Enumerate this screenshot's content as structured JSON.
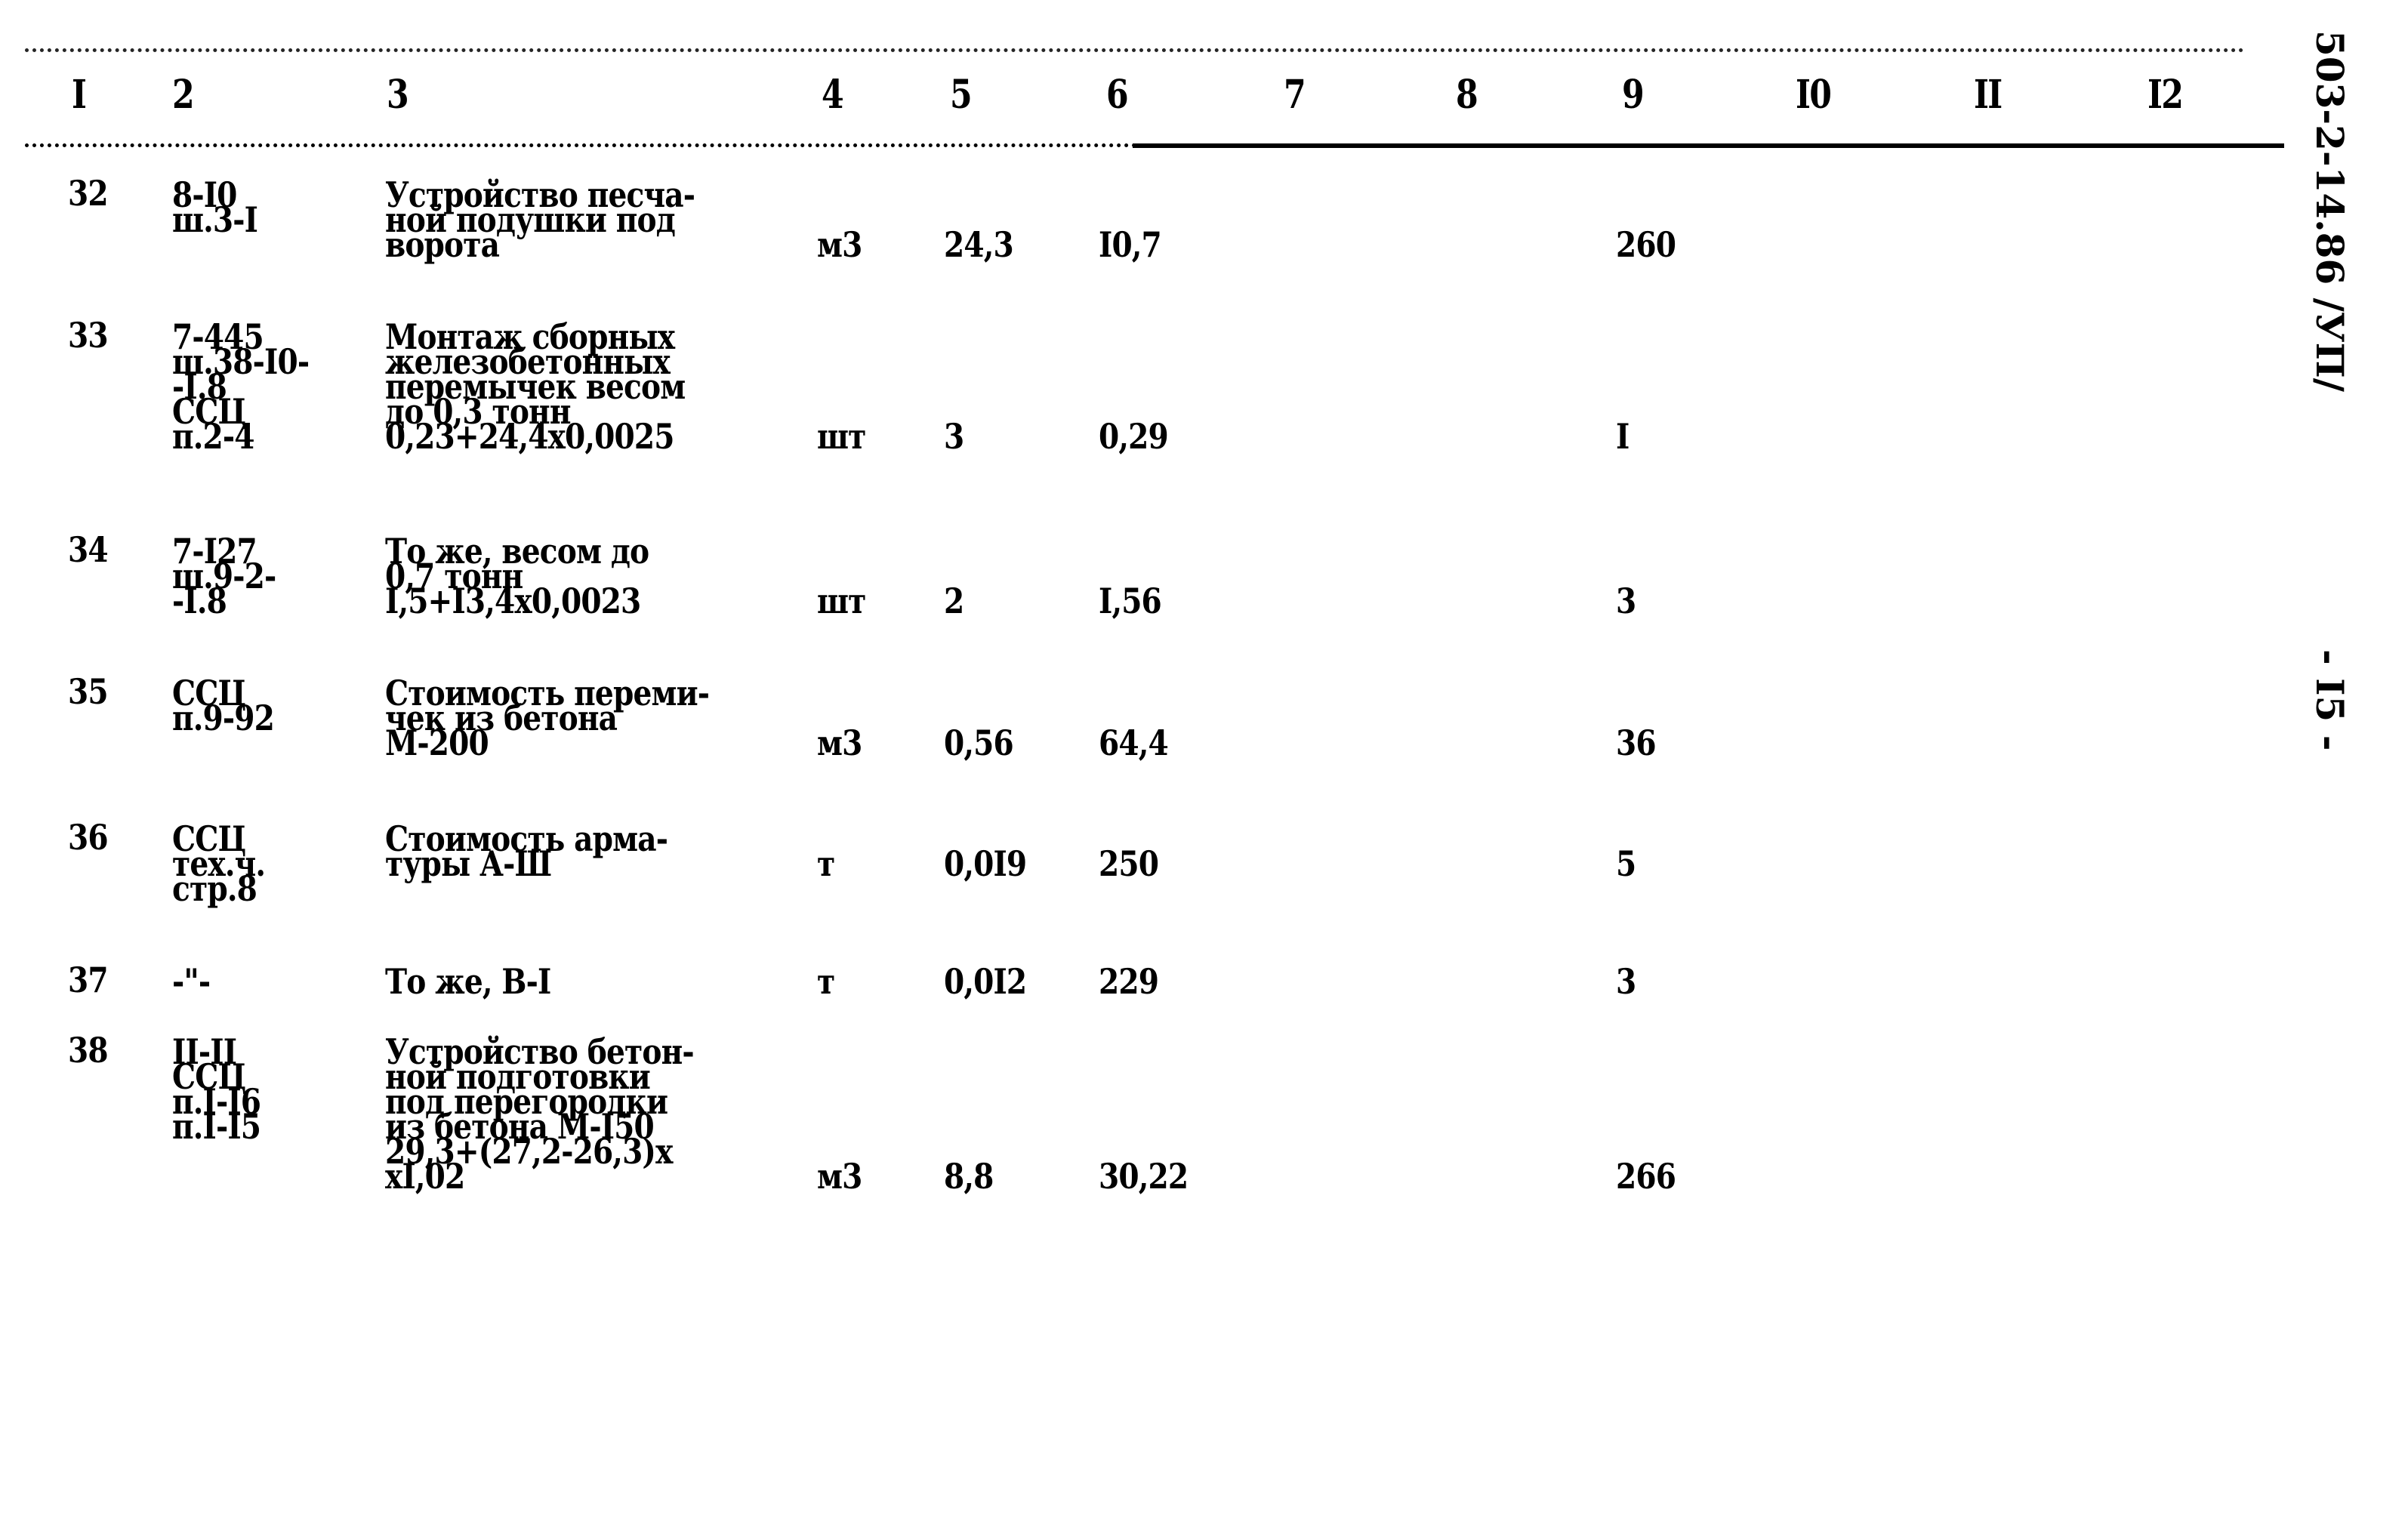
{
  "document": {
    "side_code": "503-2-14.86 /УП/",
    "page_number": "- I5 -"
  },
  "table": {
    "headers": [
      "I",
      "2",
      "3",
      "4",
      "5",
      "6",
      "7",
      "8",
      "9",
      "I0",
      "II",
      "I2"
    ],
    "rows": [
      {
        "no": "32",
        "ref": [
          "8-I0",
          "ш.3-I"
        ],
        "desc": [
          "Устройство песча-",
          "ной подушки под",
          "ворота"
        ],
        "unit": "м3",
        "qty": "24,3",
        "price": "I0,7",
        "c7": "",
        "c8": "",
        "total": "260",
        "c10": "",
        "c11": "",
        "c12": ""
      },
      {
        "no": "33",
        "ref": [
          "7-445",
          "ш.38-I0-",
          "-I.8",
          "ССЦ",
          "п.2-4"
        ],
        "desc": [
          "Монтаж сборных",
          "железобетонных",
          "перемычек весом",
          "до 0,3 тонн",
          "0,23+24,4x0,0025"
        ],
        "unit": "шт",
        "qty": "3",
        "price": "0,29",
        "c7": "",
        "c8": "",
        "total": "I",
        "c10": "",
        "c11": "",
        "c12": ""
      },
      {
        "no": "34",
        "ref": [
          "7-I27",
          "ш.9-2-",
          "-I.8"
        ],
        "desc": [
          "То же, весом до",
          "0,7 тонн",
          "I,5+I3,4x0,0023"
        ],
        "unit": "шт",
        "qty": "2",
        "price": "I,56",
        "c7": "",
        "c8": "",
        "total": "3",
        "c10": "",
        "c11": "",
        "c12": ""
      },
      {
        "no": "35",
        "ref": [
          "ССЦ",
          "п.9-92"
        ],
        "desc": [
          "Стоимость переми-",
          "чек из бетона",
          "М-200"
        ],
        "unit": "м3",
        "qty": "0,56",
        "price": "64,4",
        "c7": "",
        "c8": "",
        "total": "36",
        "c10": "",
        "c11": "",
        "c12": ""
      },
      {
        "no": "36",
        "ref": [
          "ССЦ",
          "тех.ч.",
          "стр.8"
        ],
        "desc": [
          "Стоимость арма-",
          "туры А-Ш"
        ],
        "unit": "т",
        "qty": "0,0I9",
        "price": "250",
        "c7": "",
        "c8": "",
        "total": "5",
        "c10": "",
        "c11": "",
        "c12": ""
      },
      {
        "no": "37",
        "ref": [
          "-\"-"
        ],
        "desc": [
          "То же, В-I"
        ],
        "unit": "т",
        "qty": "0,0I2",
        "price": "229",
        "c7": "",
        "c8": "",
        "total": "3",
        "c10": "",
        "c11": "",
        "c12": ""
      },
      {
        "no": "38",
        "ref": [
          "II-II",
          "ССЦ",
          "п.I-I6",
          "п.I-I5"
        ],
        "desc": [
          "Устройство бетон-",
          "ной подготовки",
          "под перегородки",
          "из бетона М-I50",
          "29,3+(27,2-26,3)x",
          "xI,02"
        ],
        "unit": "м3",
        "qty": "8,8",
        "price": "30,22",
        "c7": "",
        "c8": "",
        "total": "266",
        "c10": "",
        "c11": "",
        "c12": ""
      }
    ]
  }
}
